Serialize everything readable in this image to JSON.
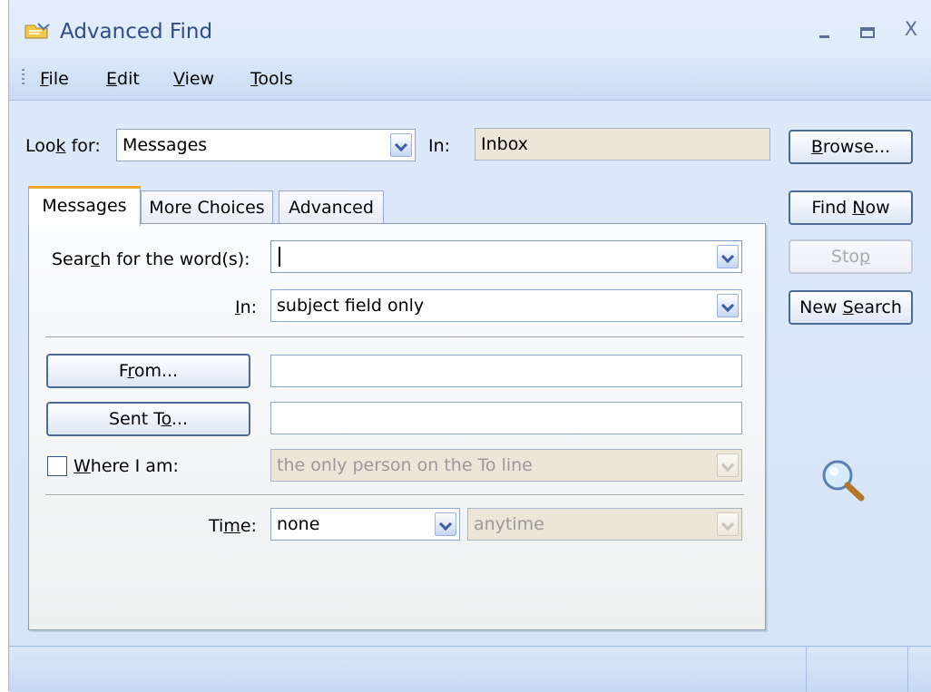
{
  "window": {
    "title": "Advanced Find",
    "icon": "advanced-find-app-icon",
    "controls": {
      "minimize": "_",
      "maximize": "▬",
      "close": "X"
    }
  },
  "menu": [
    {
      "hotkey": "F",
      "rest": "ile"
    },
    {
      "hotkey": "E",
      "rest": "dit"
    },
    {
      "hotkey": "V",
      "rest": "iew"
    },
    {
      "hotkey": "T",
      "rest": "ools"
    }
  ],
  "look_for": {
    "label_pre": "Loo",
    "label_key": "k",
    "label_post": " for:",
    "value": "Messages",
    "in_label": "In:",
    "in_value": "Inbox"
  },
  "buttons": {
    "browse": {
      "key": "B",
      "rest": "rowse..."
    },
    "find_now": {
      "pre": "Find ",
      "key": "N",
      "post": "ow"
    },
    "stop": {
      "pre": "Sto",
      "key": "p",
      "post": ""
    },
    "new_search": {
      "pre": "New ",
      "key": "S",
      "post": "earch"
    }
  },
  "tabs": [
    "Messages",
    "More Choices",
    "Advanced"
  ],
  "messages_tab": {
    "search_label": {
      "pre": "Sear",
      "key": "c",
      "post": "h for the word(s):"
    },
    "search_value": "",
    "in_label": {
      "pre": "",
      "key": "I",
      "post": "n:"
    },
    "in_value": "subject field only",
    "from_button": {
      "pre": "F",
      "key": "r",
      "post": "om..."
    },
    "from_value": "",
    "sent_to_button": {
      "pre": "Sent T",
      "key": "o",
      "post": "..."
    },
    "sent_to_value": "",
    "where_label": {
      "pre": "",
      "key": "W",
      "post": "here I am:"
    },
    "where_checked": false,
    "where_value": "the only person on the To line",
    "time_label": {
      "pre": "Ti",
      "key": "m",
      "post": "e:"
    },
    "time_value": "none",
    "time_range_value": "anytime"
  },
  "icons": {
    "magnifier": "magnifier-icon"
  }
}
